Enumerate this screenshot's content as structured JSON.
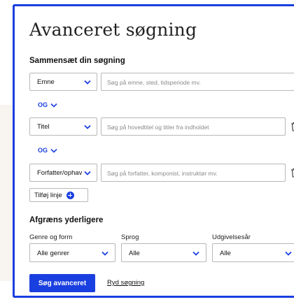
{
  "panel": {
    "title": "Avanceret søgning",
    "compose_heading": "Sammensæt din søgning"
  },
  "search_rows": [
    {
      "field": "Emne",
      "placeholder": "Søg på emne, sted, tidsperiode mv.",
      "has_delete": false
    },
    {
      "field": "Titel",
      "placeholder": "Søg på hovedtitel og titler fra indholdet",
      "has_delete": true
    },
    {
      "field": "Forfatter/ophav",
      "placeholder": "Søg på forfatter, komponist, instruktør mv.",
      "has_delete": true
    }
  ],
  "operators": [
    "OG",
    "OG"
  ],
  "add_line_label": "Tilføj linje",
  "filters": {
    "heading": "Afgræns yderligere",
    "genre": {
      "label": "Genre og form",
      "value": "Alle genrer"
    },
    "language": {
      "label": "Sprog",
      "value": "Alle"
    },
    "year": {
      "label": "Udgivelsesår",
      "value": "Alle"
    }
  },
  "actions": {
    "submit_label": "Søg avanceret",
    "clear_label": "Ryd søgning"
  },
  "colors": {
    "accent": "#1a3fe0",
    "background": "#f8f4ef"
  }
}
